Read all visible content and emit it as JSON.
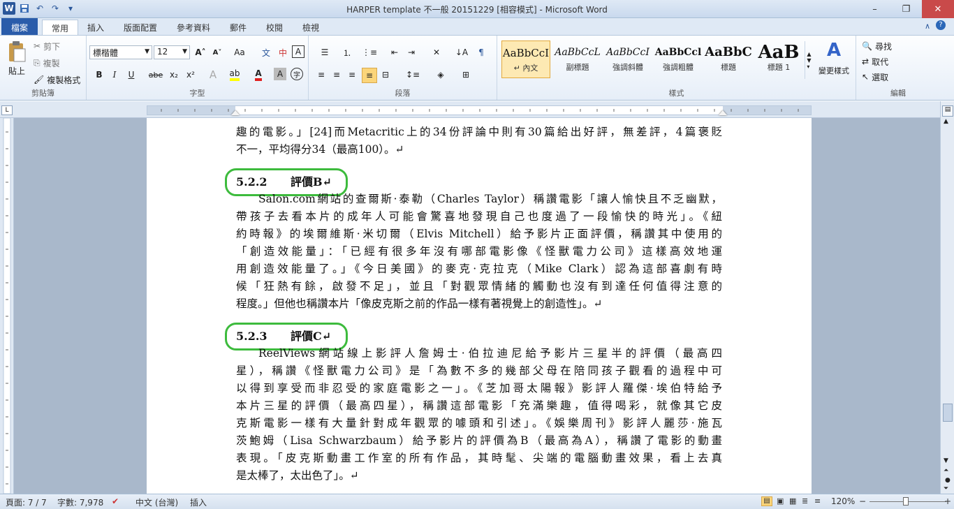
{
  "window": {
    "title": "HARPER template 不一般 20151229 [相容模式] - Microsoft Word",
    "minimize": "–",
    "restore": "❐",
    "close": "✕"
  },
  "qat": {
    "logo": "W",
    "save": "💾",
    "undo": "↶",
    "redo": "↷",
    "customize": "▾"
  },
  "tabs": [
    {
      "label": "檔案"
    },
    {
      "label": "常用"
    },
    {
      "label": "插入"
    },
    {
      "label": "版面配置"
    },
    {
      "label": "參考資料"
    },
    {
      "label": "郵件"
    },
    {
      "label": "校閱"
    },
    {
      "label": "檢視"
    }
  ],
  "ribbon": {
    "clipboard": {
      "label": "剪貼簿",
      "paste": "貼上",
      "cut": "剪下",
      "copy": "複製",
      "format_painter": "複製格式"
    },
    "font": {
      "label": "字型",
      "font_name": "標楷體",
      "font_size": "12",
      "grow": "A˄",
      "shrink": "A˅",
      "case": "Aa",
      "bold": "B",
      "italic": "I",
      "underline": "U",
      "strike": "abe",
      "sub": "x₂",
      "sup": "x²"
    },
    "paragraph": {
      "label": "段落"
    },
    "styles": {
      "label": "樣式",
      "items": [
        {
          "sample": "AaBbCcI",
          "name": "↵ 內文"
        },
        {
          "sample": "AaBbCcL",
          "name": "副標題"
        },
        {
          "sample": "AaBbCcI",
          "name": "強調斜體"
        },
        {
          "sample": "AaBbCcl",
          "name": "強調粗體"
        },
        {
          "sample": "AaBbC",
          "name": "標題"
        },
        {
          "sample": "AaB",
          "name": "標題 1"
        }
      ],
      "change_styles": "變更樣式"
    },
    "editing": {
      "label": "編輯",
      "find": "尋找",
      "replace": "取代",
      "select": "選取"
    }
  },
  "document": {
    "para1": [
      "趣的電影。」[24]而Metacritic上的34份評論中則有30篇給出好評，無差評，4篇褒貶",
      "不一，平均得分34（最高100）。↵"
    ],
    "heading_b": {
      "num": "5.2.2",
      "text": "評價B↵"
    },
    "para2": [
      "Salon.com網站的查爾斯·泰勒（Charles Taylor）稱讚電影「讓人愉快且不乏幽默，",
      "帶孩子去看本片的成年人可能會驚喜地發現自己也度過了一段愉快的時光」。《紐",
      "約時報》的埃爾維斯·米切爾（Elvis Mitchell）給予影片正面評價，稱讚其中使用的",
      "「創造效能量」：「已經有很多年沒有哪部電影像《怪獸電力公司》這樣高效地運",
      "用創造效能量了。」《今日美國》的麥克·克拉克（Mike Clark）認為這部喜劇有時",
      "候「狂熱有餘，啟發不足」，並且「對觀眾情緒的觸動也沒有到達任何值得注意的",
      "程度。」但他也稱讚本片「像皮克斯之前的作品一樣有著視覺上的創造性」。↵"
    ],
    "heading_c": {
      "num": "5.2.3",
      "text": "評價C↵"
    },
    "para3": [
      "ReelViews網站線上影評人詹姆士·伯拉迪尼給予影片三星半的評價（最高四",
      "星），稱讚《怪獸電力公司》是「為數不多的幾部父母在陪同孩子觀看的過程中可",
      "以得到享受而非忍受的家庭電影之一」。《芝加哥太陽報》影評人羅傑·埃伯特給予",
      "本片三星的評價（最高四星），稱讚這部電影「充滿樂趣，值得喝彩，就像其它皮",
      "克斯電影一樣有大量針對成年觀眾的噱頭和引述」。《娛樂周刊》影評人麗莎·施瓦",
      "茨鮑姆（Lisa Schwarzbaum）給予影片的評價為B（最高為A），稱讚了電影的動畫",
      "表現。「皮克斯動畫工作室的所有作品，其時髦、尖端的電腦動畫效果，看上去真",
      "是太棒了，太出色了」。↵"
    ]
  },
  "status": {
    "page": "頁面: 7 / 7",
    "words": "字數: 7,978",
    "language": "中文 (台灣)",
    "mode": "插入",
    "zoom": "120%",
    "zoom_out": "−",
    "zoom_in": "+"
  },
  "colors": {
    "accent": "#2a5caa",
    "highlight_oval": "#3dbb3d"
  }
}
